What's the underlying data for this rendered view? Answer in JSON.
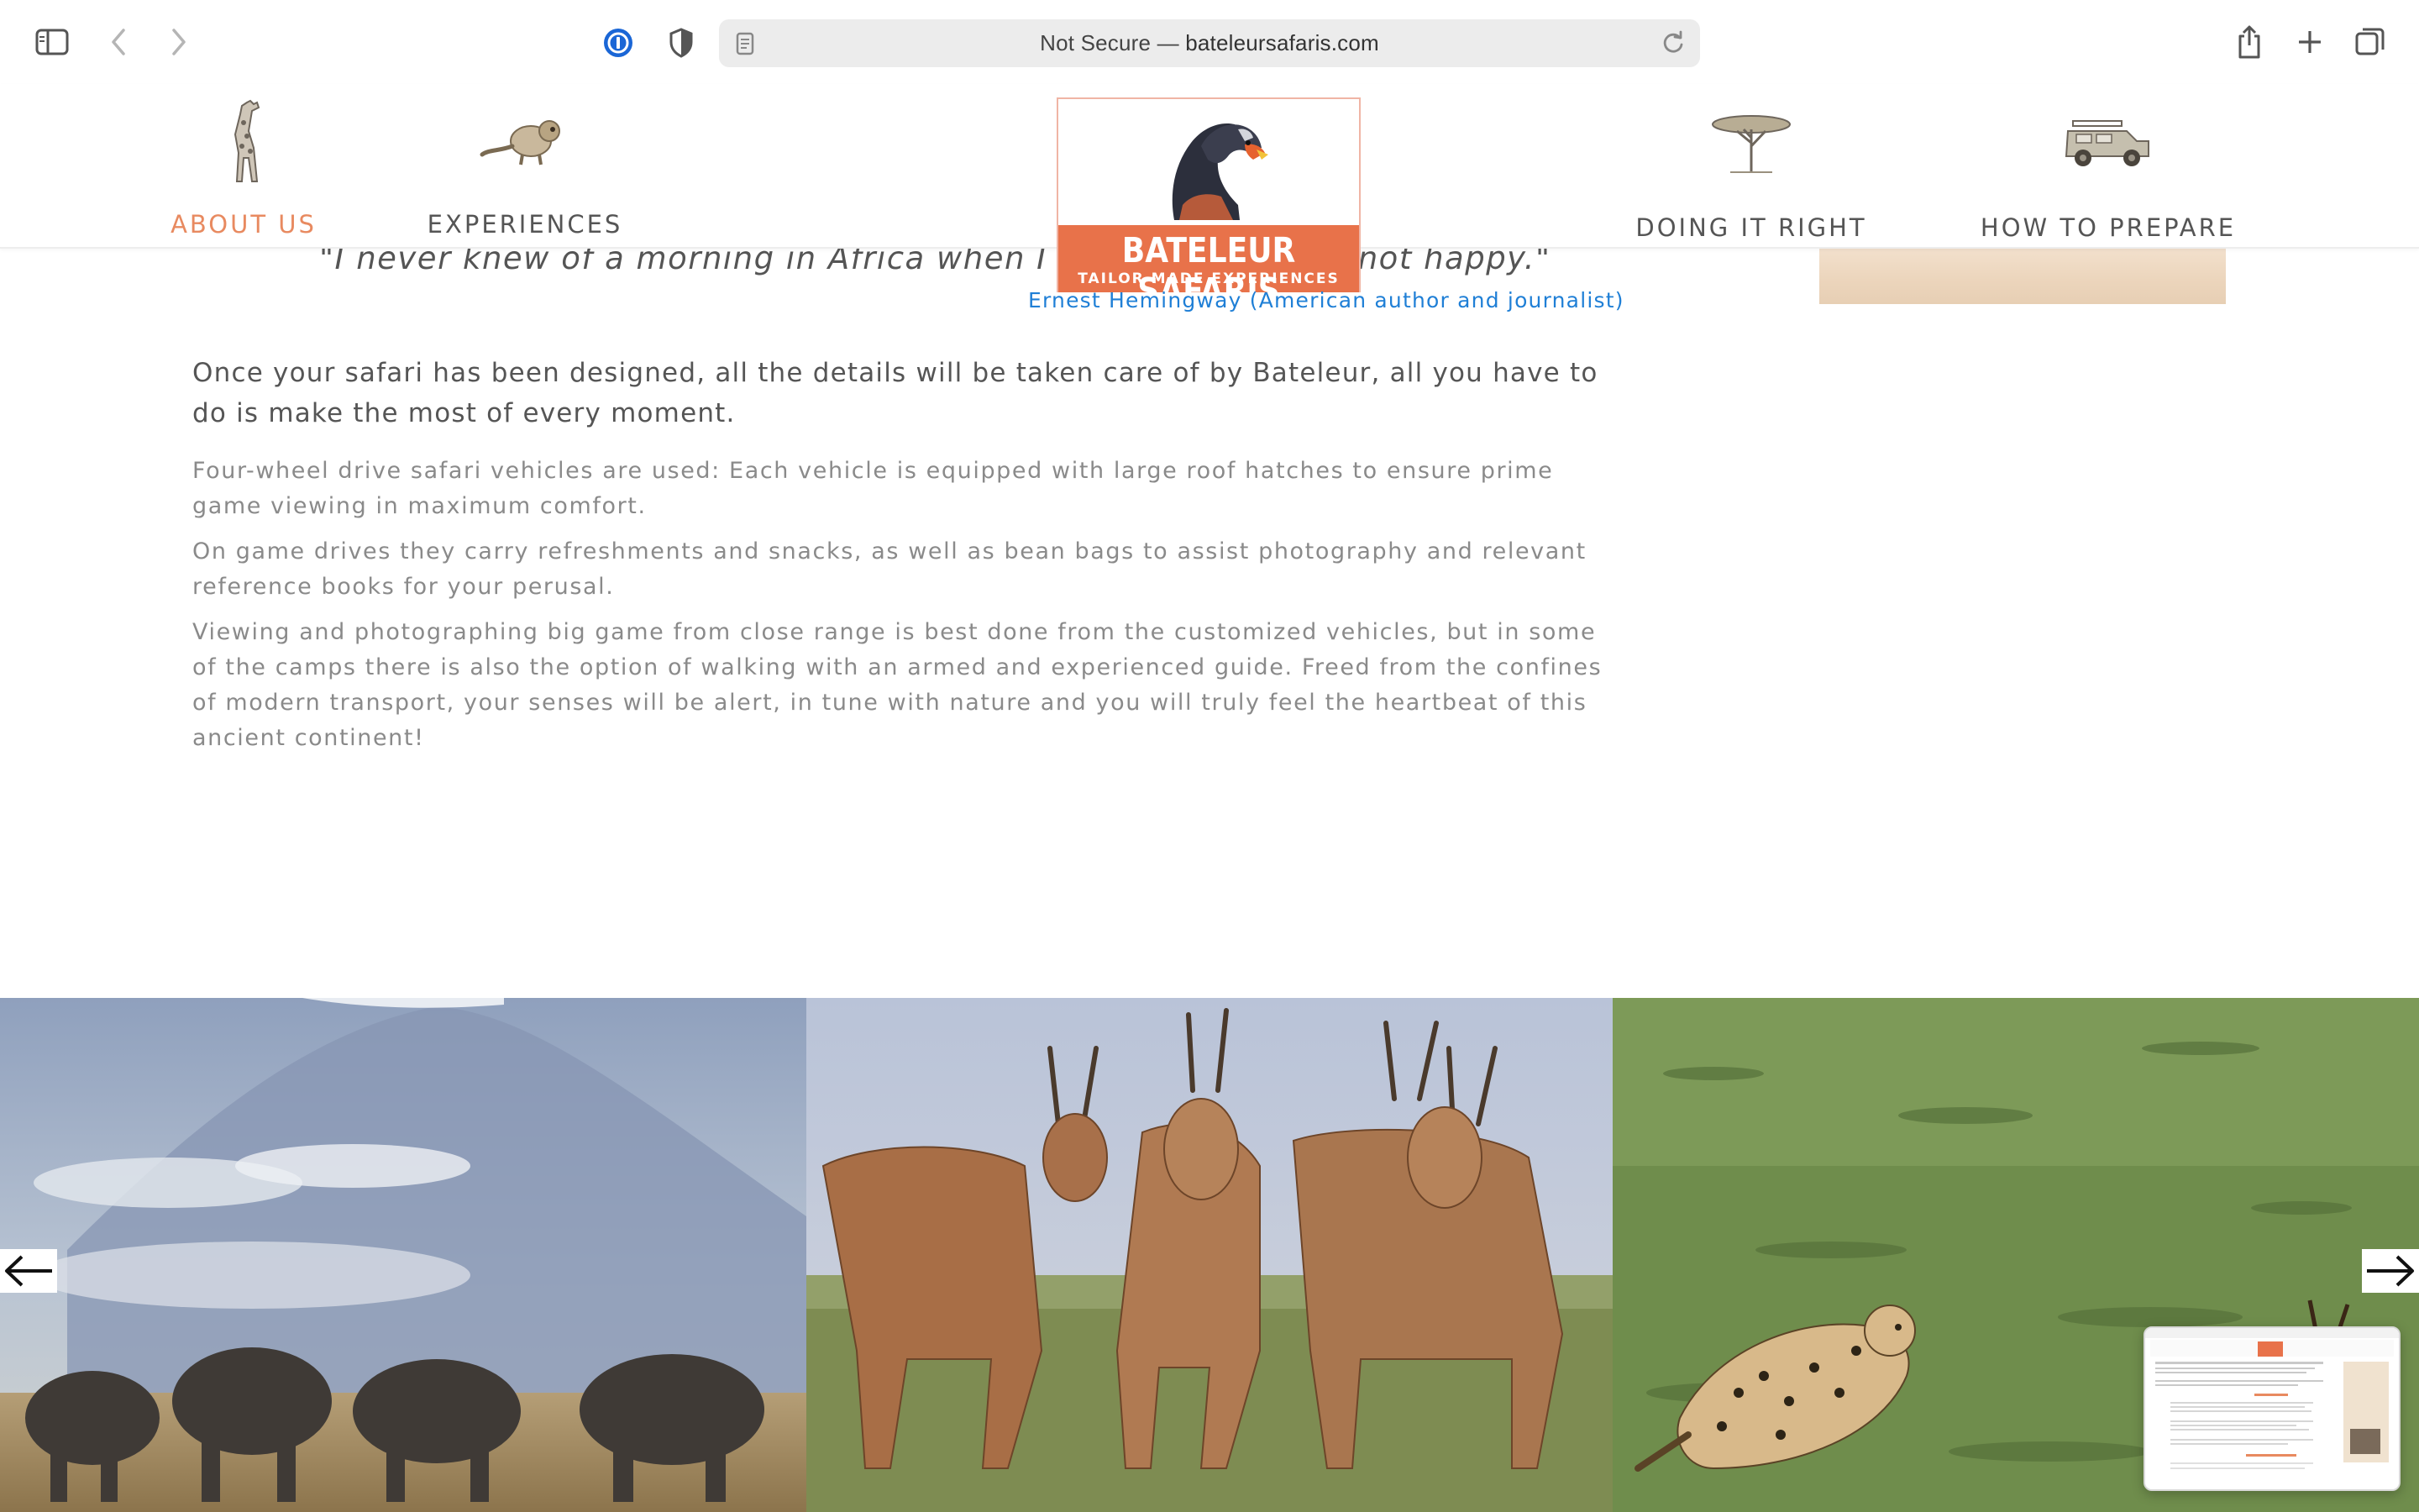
{
  "browser": {
    "address": {
      "security_label": "Not Secure —",
      "domain": "bateleursafaris.com"
    },
    "icons": {
      "sidebar": "sidebar-icon",
      "back": "chevron-left-icon",
      "forward": "chevron-right-icon",
      "password": "password-manager-icon",
      "privacy": "privacy-shield-icon",
      "reader": "page-icon",
      "reload": "reload-icon",
      "share": "share-icon",
      "new_tab": "plus-icon",
      "tabs": "tab-overview-icon"
    }
  },
  "site": {
    "nav": [
      {
        "label": "ABOUT US",
        "icon": "giraffe-icon",
        "active": true
      },
      {
        "label": "EXPERIENCES",
        "icon": "lemur-icon",
        "active": false
      },
      {
        "label": "DOING IT RIGHT",
        "icon": "acacia-tree-icon",
        "active": false
      },
      {
        "label": "HOW TO PREPARE",
        "icon": "safari-vehicle-icon",
        "active": false
      }
    ],
    "logo": {
      "name": "BATELEUR SAFARIS",
      "tagline": "TAILOR MADE EXPERIENCES"
    },
    "colors": {
      "accent": "#e88a60",
      "logo_band": "#e8724a",
      "link": "#1f7fd6"
    }
  },
  "content": {
    "quote": "\"I never knew of a morning in Africa when I woke up and was not happy.\"",
    "quote_author": "Ernest Hemingway (American author and journalist)",
    "lead": "Once your safari has been designed, all the details will be taken care of by Bateleur, all you have to do is make the most of every moment.",
    "paragraphs": [
      "Four-wheel drive safari vehicles are used: Each vehicle is equipped with large roof hatches to ensure prime game viewing in maximum comfort.",
      "On game drives they carry refreshments and snacks, as well as bean bags to assist photography and relevant reference books for your perusal.",
      "Viewing and photographing big game from close range is best done from the customized vehicles, but in some of the camps there is also the option of walking with an armed and experienced guide. Freed from the confines of modern transport, your senses will be alert, in tune with nature and you will truly feel the heartbeat of this ancient continent!"
    ]
  },
  "gallery": {
    "slides": [
      "elephants-kilimanjaro-photo",
      "eland-herd-photo",
      "cheetah-chase-photo"
    ],
    "prev_icon": "arrow-left-icon",
    "next_icon": "arrow-right-icon"
  }
}
